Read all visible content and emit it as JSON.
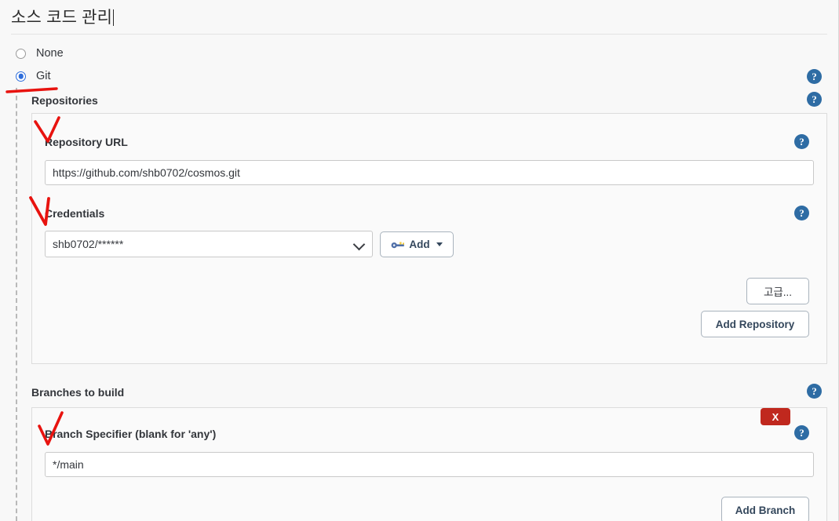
{
  "page": {
    "title": "소스 코드 관리"
  },
  "scm_options": [
    {
      "label": "None",
      "selected": false
    },
    {
      "label": "Git",
      "selected": true
    }
  ],
  "repositories": {
    "group_label": "Repositories",
    "repository_url": {
      "label": "Repository URL",
      "value": "https://github.com/shb0702/cosmos.git"
    },
    "credentials": {
      "label": "Credentials",
      "selected_value": "shb0702/******",
      "add_button_label": "Add"
    },
    "advanced_button_label": "고급...",
    "add_repository_button_label": "Add Repository"
  },
  "branches": {
    "group_label": "Branches to build",
    "branch_specifier": {
      "label": "Branch Specifier (blank for 'any')",
      "value": "*/main"
    },
    "delete_button_label": "X",
    "add_branch_button_label": "Add Branch"
  },
  "help": {
    "glyph": "?"
  },
  "colors": {
    "accent_blue": "#2d6ddb",
    "help_blue": "#2e6ca4",
    "delete_red": "#c0281e",
    "annotation_red": "#e8130f",
    "panel_bg": "#fafafa",
    "page_bg": "#f8f8f8"
  }
}
